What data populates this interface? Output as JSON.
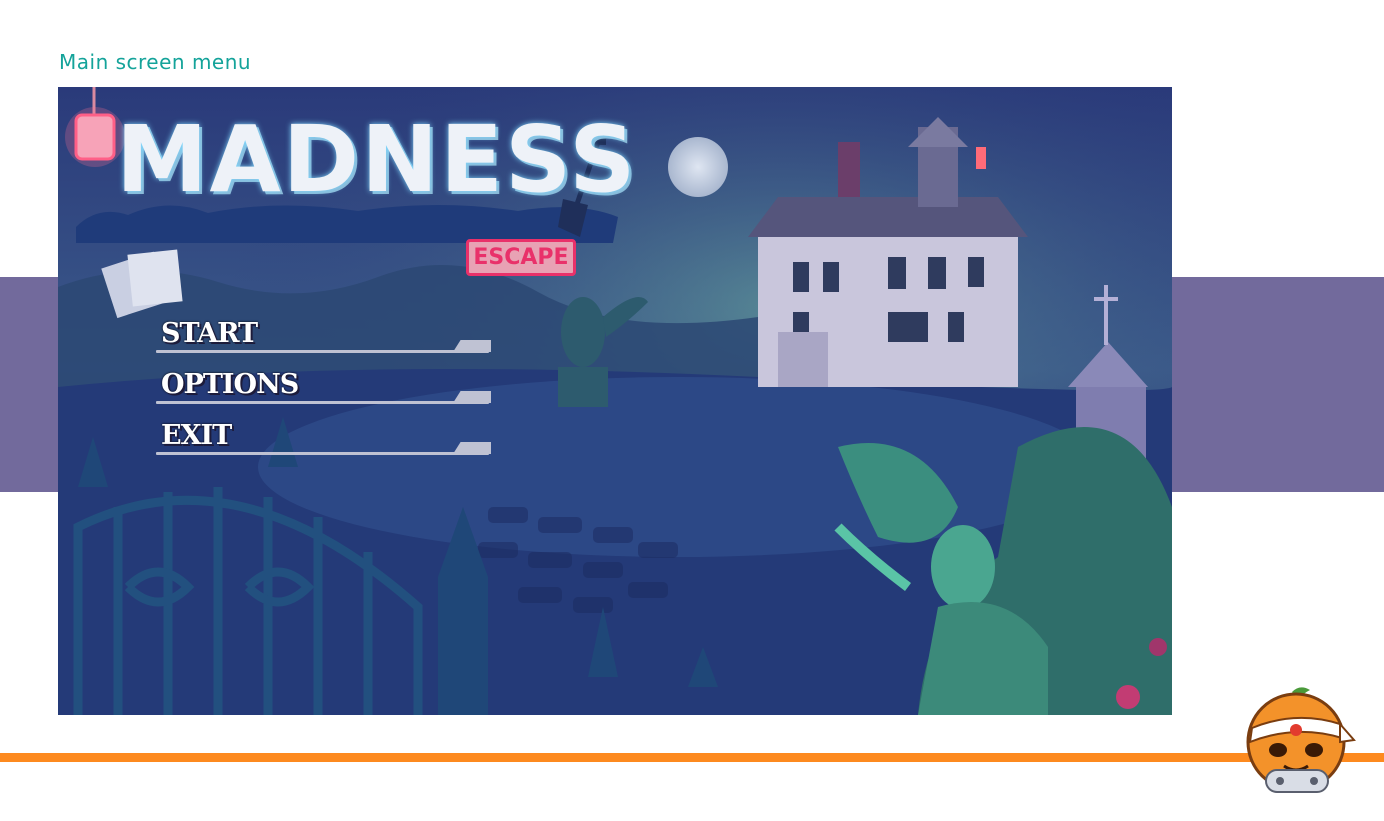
{
  "caption": "Main screen menu",
  "game": {
    "logo_title": "MADNESS",
    "logo_subtitle": "ESCAPE",
    "menu": [
      {
        "label": "START"
      },
      {
        "label": "OPTIONS"
      },
      {
        "label": "EXIT"
      }
    ]
  },
  "colors": {
    "caption": "#14a39a",
    "band": "#726a9c",
    "accent_line": "#fd8a1f",
    "escape_sign": "#e9316a"
  },
  "icons": {
    "notes": "papers-icon",
    "mascot": "orange-gamepad-mascot-icon"
  }
}
